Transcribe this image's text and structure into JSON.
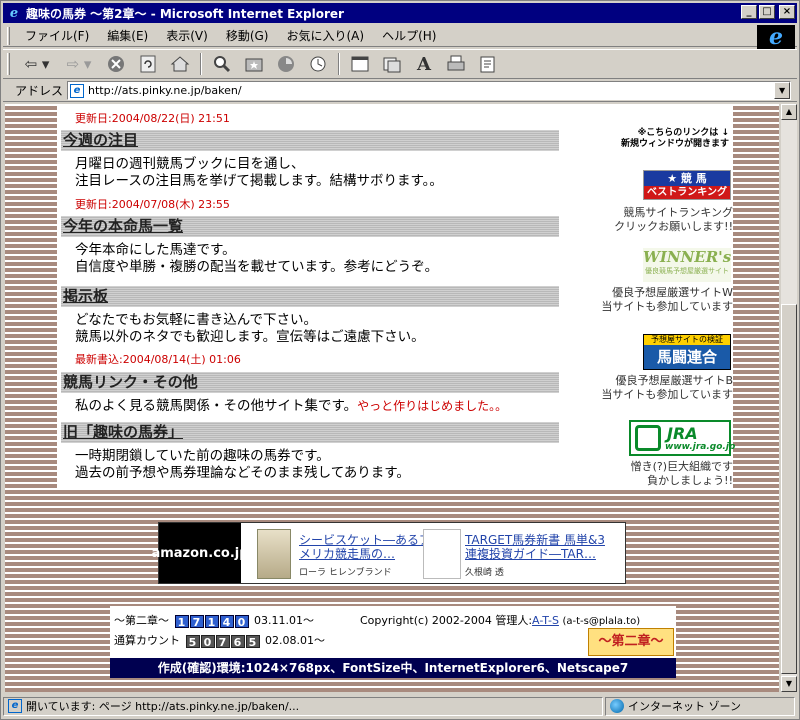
{
  "window": {
    "title": "趣味の馬券 ～第2章～ - Microsoft Internet Explorer",
    "btn_min": "_",
    "btn_max": "□",
    "btn_close": "×"
  },
  "menu": [
    "ファイル(F)",
    "編集(E)",
    "表示(V)",
    "移動(G)",
    "お気に入り(A)",
    "ヘルプ(H)"
  ],
  "address": {
    "label": "アドレス",
    "url": "http://ats.pinky.ne.jp/baken/"
  },
  "page": {
    "top_update": "更新日:2004/08/22(日) 21:51",
    "sections": [
      {
        "heading": "今週の注目",
        "lines": [
          "月曜日の週刊競馬ブックに目を通し、",
          "注目レースの注目馬を挙げて掲載します。結構サボります。。"
        ],
        "update": "更新日:2004/07/08(木) 23:55"
      },
      {
        "heading": "今年の本命馬一覧",
        "lines": [
          "今年本命にした馬達です。",
          "自信度や単勝・複勝の配当を載せています。参考にどうぞ。"
        ]
      },
      {
        "heading": "掲示板",
        "lines": [
          "どなたでもお気軽に書き込んで下さい。",
          "競馬以外のネタでも歓迎します。宣伝等はご遠慮下さい。"
        ],
        "update": "最新書込:2004/08/14(土) 01:06"
      },
      {
        "heading": "競馬リンク・その他",
        "lines": [
          "私のよく見る競馬関係・その他サイト集です。"
        ],
        "note": "やっと作りはじめました。。"
      },
      {
        "heading": "旧「趣味の馬券」",
        "lines": [
          "一時期閉鎖していた前の趣味の馬券です。",
          "過去の前予想や馬券理論などそのまま残してあります。"
        ]
      }
    ],
    "sidebar": {
      "notice": [
        "※こちらのリンクは",
        "新規ウィンドウが開きます"
      ],
      "notice_arrow": "↓",
      "banners": [
        {
          "text_top": "★ 競 馬",
          "text_bottom": "ベストランキング",
          "caption": [
            "競馬サイトランキング",
            "クリックお願いします!!"
          ]
        },
        {
          "text_top": "WINNER's",
          "text_bottom": "優良競馬予想屋厳選サイト",
          "caption": [
            "優良予想屋厳選サイトW",
            "当サイトも参加しています"
          ]
        },
        {
          "text_top": "予想屋サイトの検証",
          "text_bottom": "馬闘連合",
          "caption": [
            "優良予想屋厳選サイトB",
            "当サイトも参加しています"
          ]
        },
        {
          "text_top": "JRA",
          "text_bottom": "www.jra.go.jp",
          "caption": [
            "憎き(?)巨大組織です",
            "負かしましょう!!"
          ]
        }
      ]
    },
    "amazon": {
      "logo": "amazon.co.jp",
      "book1_title": [
        "シービスケット―あるア",
        "メリカ競走馬の…"
      ],
      "book1_author": "ローラ ヒレンブランド",
      "book2_title": [
        "TARGET馬券新書 馬単&3",
        "連複投資ガイド―TAR…"
      ],
      "book2_author": "久根崎 透"
    },
    "footer": {
      "chapter": "～第二章～",
      "count1": [
        "1",
        "7",
        "1",
        "4",
        "0"
      ],
      "date1": "03.11.01～",
      "total_label": "通算カウント",
      "count2": [
        "5",
        "0",
        "7",
        "6",
        "5"
      ],
      "date2": "02.08.01～",
      "copyright": "Copyright(c) 2002-2004 管理人:",
      "admin": "A-T-S",
      "email": "(a-t-s@plala.to)",
      "logo": "～第二章～",
      "env": "作成(確認)環境:1024×768px、FontSize中、InternetExplorer6、Netscape7"
    }
  },
  "status": {
    "left": "開いています: ページ http://ats.pinky.ne.jp/baken/...",
    "zone": "インターネット ゾーン"
  }
}
